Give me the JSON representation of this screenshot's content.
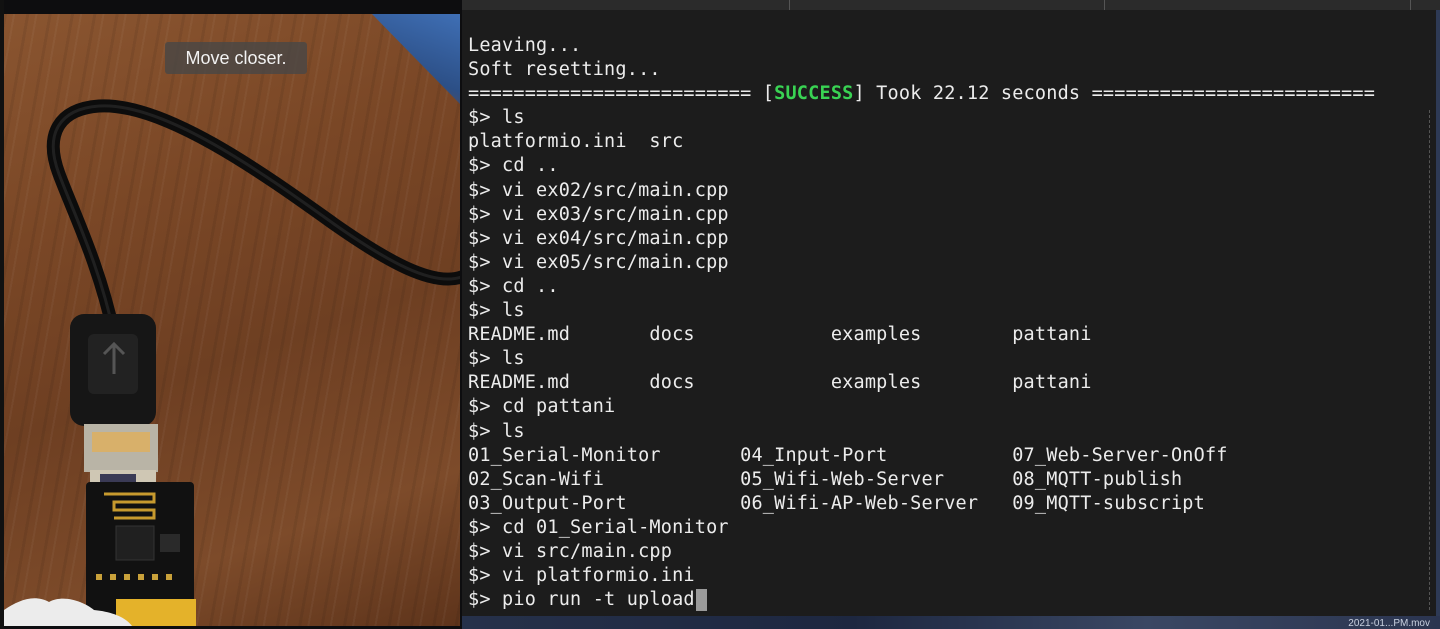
{
  "camera": {
    "toast_text": "Move closer."
  },
  "terminal": {
    "lines": [
      {
        "pre": "Leaving..."
      },
      {
        "pre": "Soft resetting..."
      },
      {
        "pre": "========================= [",
        "success": "SUCCESS",
        "post": "] Took 22.12 seconds ========================="
      },
      {
        "pre": "$> ls"
      },
      {
        "pre": "platformio.ini  src"
      },
      {
        "pre": "$> cd .."
      },
      {
        "pre": "$> vi ex02/src/main.cpp"
      },
      {
        "pre": "$> vi ex03/src/main.cpp"
      },
      {
        "pre": "$> vi ex04/src/main.cpp"
      },
      {
        "pre": "$> vi ex05/src/main.cpp"
      },
      {
        "pre": "$> cd .."
      },
      {
        "pre": "$> ls"
      },
      {
        "pre": "README.md       docs            examples        pattani"
      },
      {
        "pre": "$> ls"
      },
      {
        "pre": "README.md       docs            examples        pattani"
      },
      {
        "pre": "$> cd pattani"
      },
      {
        "pre": "$> ls"
      },
      {
        "pre": "01_Serial-Monitor       04_Input-Port           07_Web-Server-OnOff"
      },
      {
        "pre": "02_Scan-Wifi            05_Wifi-Web-Server      08_MQTT-publish"
      },
      {
        "pre": "03_Output-Port          06_Wifi-AP-Web-Server   09_MQTT-subscript"
      },
      {
        "pre": "$> cd 01_Serial-Monitor"
      },
      {
        "pre": "$> vi src/main.cpp"
      },
      {
        "pre": "$> vi platformio.ini"
      },
      {
        "pre": "$> pio run -t upload",
        "cursor": true
      }
    ]
  },
  "wallpaper": {
    "date_text": "2021-01...PM.mov"
  },
  "colors": {
    "terminal_bg": "#1c1c1c",
    "terminal_fg": "#ececec",
    "success_green": "#39d353"
  }
}
